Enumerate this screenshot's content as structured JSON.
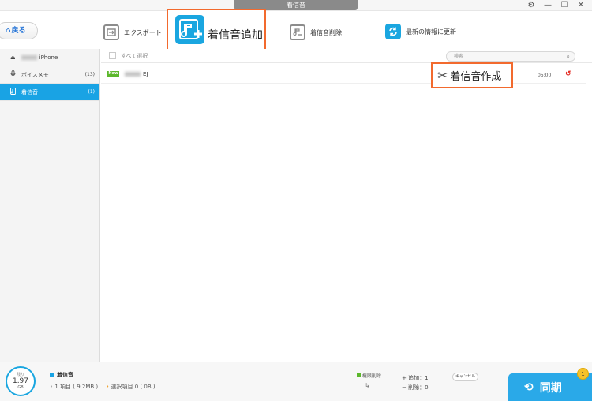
{
  "window": {
    "title": "着信音",
    "icons": [
      "settings-icon",
      "minimize-icon",
      "maximize-icon",
      "close-icon"
    ]
  },
  "toolbar": {
    "back_label": "戻る",
    "export_label": "エクスポート",
    "add_label": "着信音追加",
    "delete_label": "着信音削除",
    "refresh_label": "最新の情報に更新"
  },
  "sidebar": {
    "device_label": "iPhone",
    "items": [
      {
        "label": "ボイスメモ",
        "count": "(13)",
        "icon": "microphone-icon"
      },
      {
        "label": "着信音",
        "count": "(1)",
        "icon": "ringtone-icon",
        "active": true
      }
    ]
  },
  "list": {
    "select_all_label": "すべて選択",
    "search_placeholder": "検索",
    "rows": [
      {
        "badge": "New",
        "name": "EJ",
        "time": "05:00"
      }
    ]
  },
  "callout": {
    "make_label": "着信音作成"
  },
  "footer": {
    "storage_label": "残り",
    "storage_value": "1.97",
    "storage_unit": "GB",
    "category_title": "着信音",
    "items_info": "1 項目 ( 9.2MB )",
    "selected_info": "選択項目 0 ( 0B )",
    "diff_label": "権限削除",
    "add_info": "追加：1",
    "remove_info": "削除：0",
    "cancel_label": "キャンセル",
    "sync_label": "同期",
    "sync_badge": "1"
  },
  "colors": {
    "accent": "#1aa6e0",
    "highlight": "#f26a2e",
    "new_badge": "#5cb82c",
    "undo": "#e2231a"
  }
}
